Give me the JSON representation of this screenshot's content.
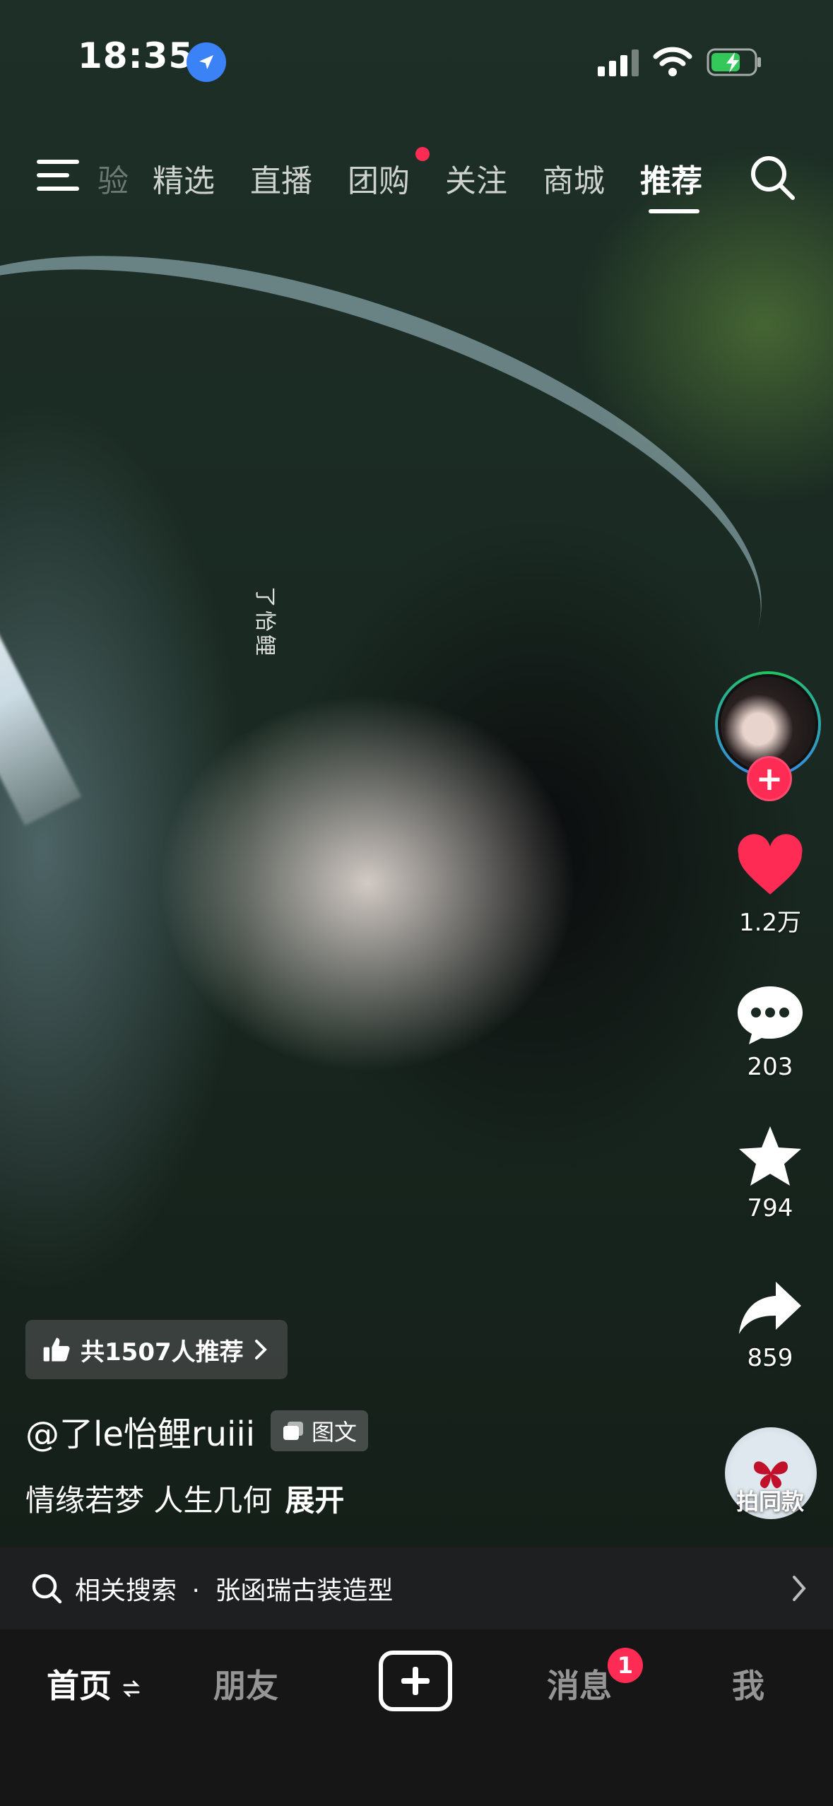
{
  "status_bar": {
    "time": "18:35"
  },
  "top_nav": {
    "tabs": [
      {
        "label": "验"
      },
      {
        "label": "精选"
      },
      {
        "label": "直播"
      },
      {
        "label": "团购"
      },
      {
        "label": "关注"
      },
      {
        "label": "商城"
      },
      {
        "label": "推荐"
      }
    ],
    "active_tab": "推荐"
  },
  "post": {
    "watermark": "了怡鲤",
    "recommend_text": "共1507人推荐",
    "author": "@了le怡鲤ruiii",
    "type_tag": "图文",
    "caption": "情缘若梦 人生几何",
    "expand_label": "展开"
  },
  "actions": {
    "likes": "1.2万",
    "comments": "203",
    "favorites": "794",
    "shares": "859",
    "music_label": "拍同款"
  },
  "related_search": {
    "prefix": "相关搜索",
    "separator": "·",
    "query": "张函瑞古装造型"
  },
  "bottom_nav": {
    "home": "首页",
    "friends": "朋友",
    "messages": "消息",
    "messages_badge": "1",
    "me": "我"
  },
  "colors": {
    "accent_red": "#fe2c55",
    "location_blue": "#3b82f6",
    "battery_green": "#34c759"
  }
}
